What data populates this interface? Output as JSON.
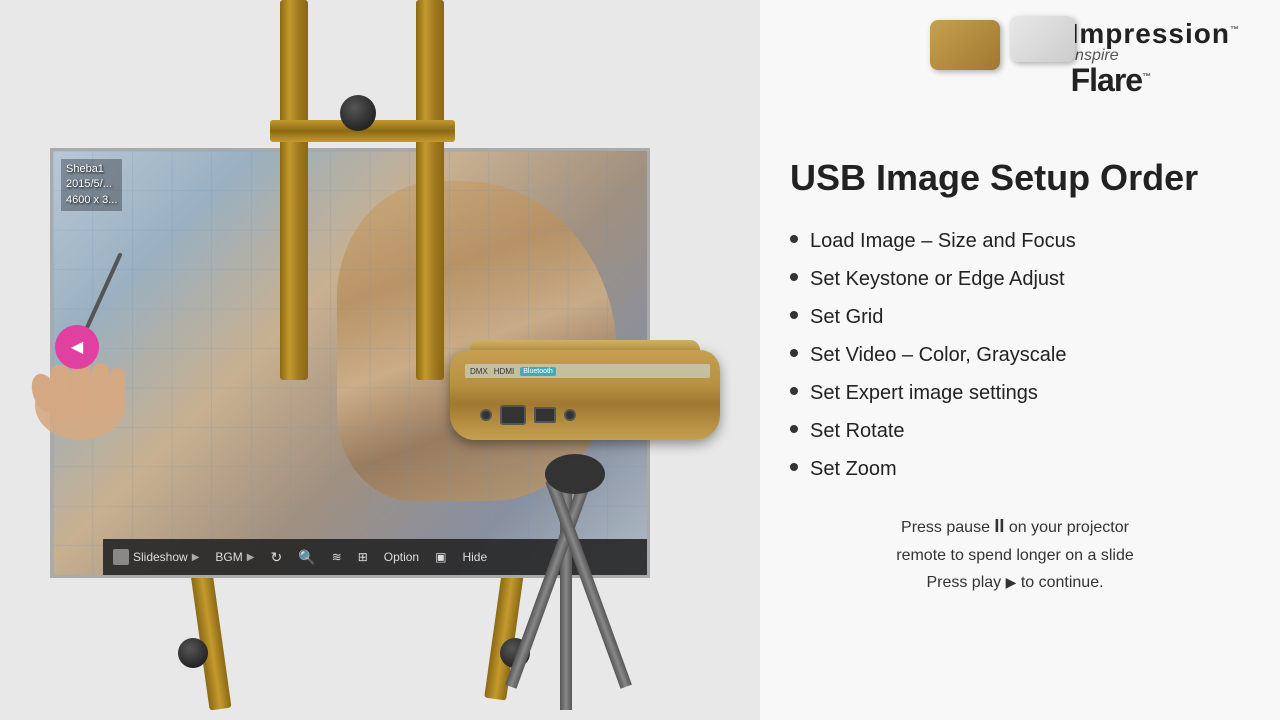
{
  "brand": {
    "name": "Impression",
    "inspire": "Inspire",
    "flare": "Flare",
    "trademark": "™"
  },
  "right_panel": {
    "title": "USB Image Setup Order",
    "bullets": [
      "Load Image – Size and Focus",
      "Set Keystone or Edge Adjust",
      "Set Grid",
      "Set Video – Color, Grayscale",
      "Set Expert image settings",
      "Set Rotate",
      "Set Zoom"
    ],
    "pause_note_line1": "Press pause",
    "pause_symbol": "II",
    "pause_note_line2": " on your projector",
    "pause_note_line3": "remote to spend longer on a slide",
    "pause_note_line4": "Press play ",
    "play_symbol": "▶",
    "pause_note_line5": " to continue."
  },
  "screen_info": {
    "line1": "Sheba1",
    "line2": "2015/5/...",
    "line3": "4600 x 3..."
  },
  "toolbar": {
    "items": [
      {
        "label": "Slideshow",
        "icon": "slideshow-icon"
      },
      {
        "label": "BGM",
        "icon": "bgm-icon"
      },
      {
        "label": "",
        "icon": "rotate-icon"
      },
      {
        "label": "",
        "icon": "zoom-icon"
      },
      {
        "label": "",
        "icon": "effect-icon"
      },
      {
        "label": "",
        "icon": "display-icon"
      },
      {
        "label": "Option",
        "icon": "option-icon"
      },
      {
        "label": "",
        "icon": "screen-icon"
      },
      {
        "label": "Hide",
        "icon": "hide-icon"
      }
    ]
  }
}
